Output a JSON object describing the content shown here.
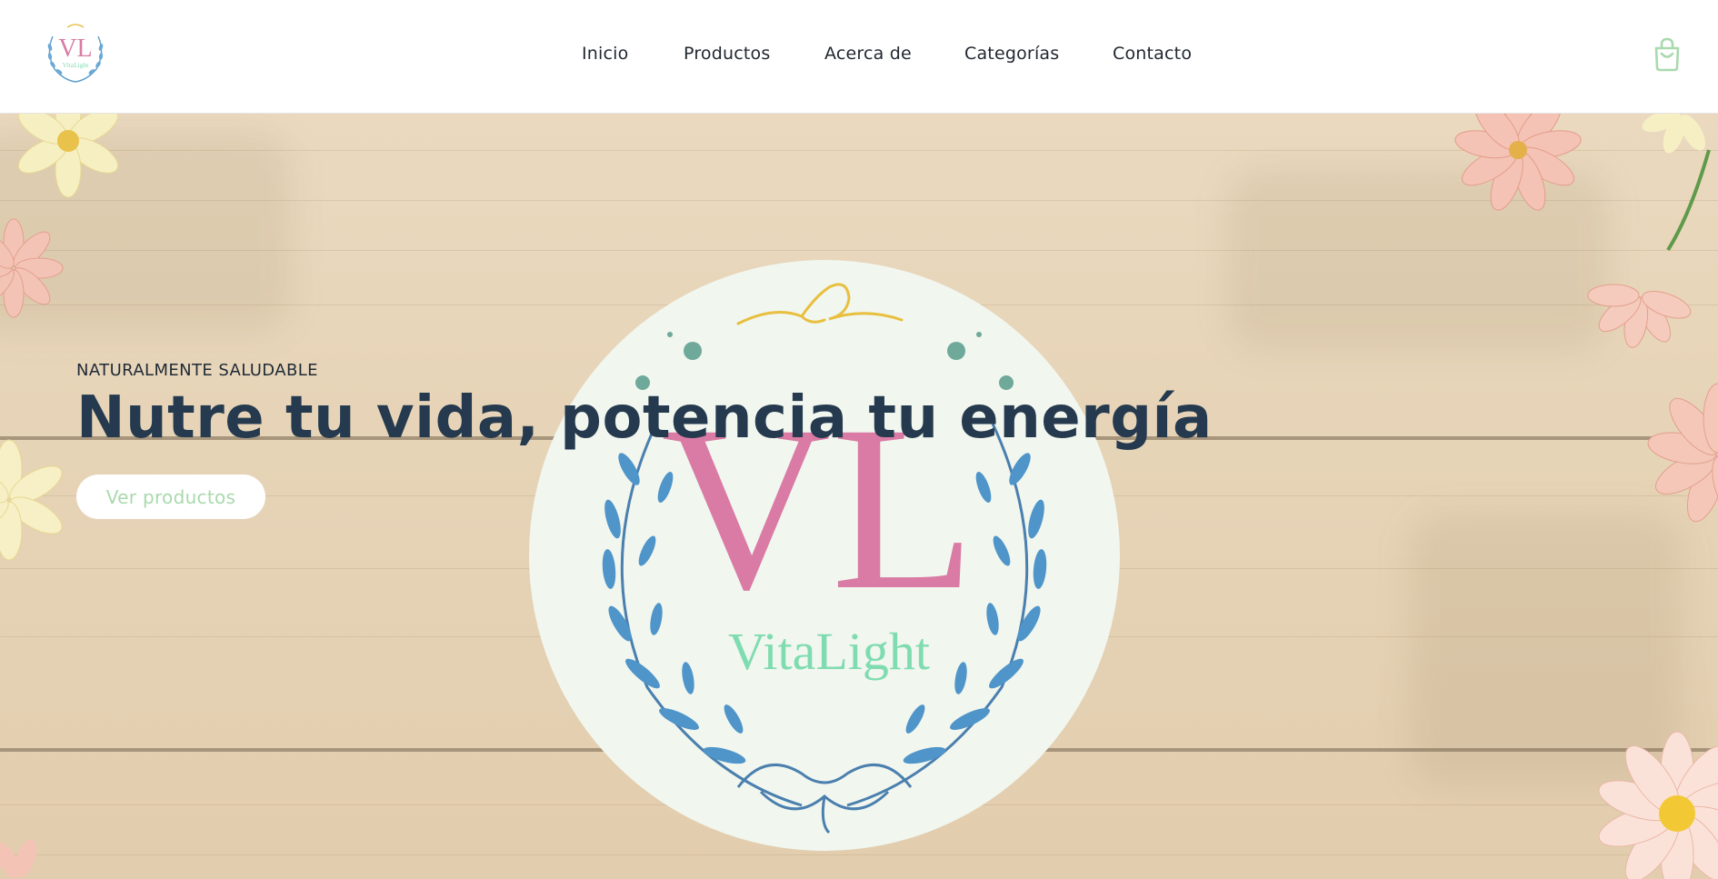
{
  "header": {
    "logo_alt": "VitaLight logo",
    "logo_monogram": "VL",
    "logo_wordmark": "VitaLight",
    "nav": [
      {
        "label": "Inicio"
      },
      {
        "label": "Productos"
      },
      {
        "label": "Acerca de"
      },
      {
        "label": "Categorías"
      },
      {
        "label": "Contacto"
      }
    ],
    "cart_icon": "shopping-bag-icon",
    "accent_color": "#a9d9ad"
  },
  "hero": {
    "eyebrow": "NATURALMENTE SALUDABLE",
    "headline": "Nutre tu vida, potencia tu energía",
    "cta_label": "Ver productos",
    "emblem_monogram": "VL",
    "emblem_wordmark": "VitaLight",
    "colors": {
      "headline": "#253a4e",
      "monogram": "#d97ba4",
      "wordmark": "#7fdcb0",
      "leaves": "#4a8fc4",
      "circle_bg": "#f1f6ef"
    }
  }
}
